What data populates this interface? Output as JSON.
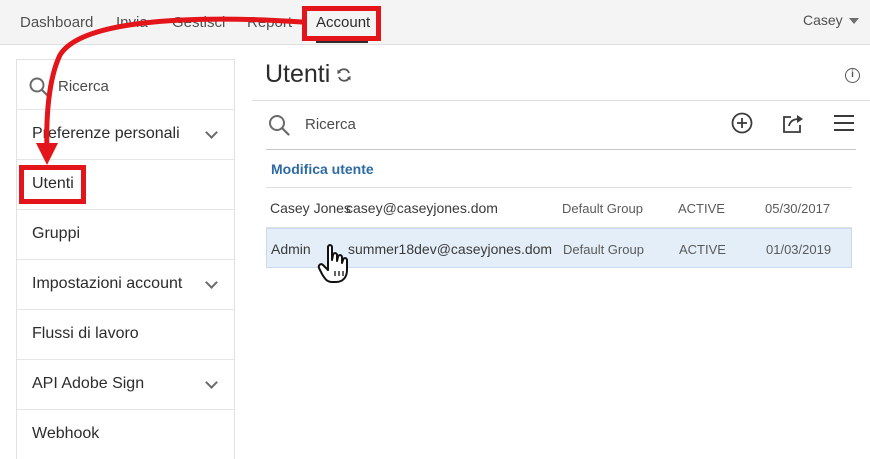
{
  "topnav": {
    "items": [
      {
        "label": "Dashboard"
      },
      {
        "label": "Invia"
      },
      {
        "label": "Gestisci"
      },
      {
        "label": "Report"
      },
      {
        "label": "Account"
      }
    ],
    "user": "Casey"
  },
  "sidebar": {
    "search_placeholder": "Ricerca",
    "items": [
      {
        "label": "Preferenze personali",
        "expandable": true
      },
      {
        "label": "Utenti",
        "expandable": false
      },
      {
        "label": "Gruppi",
        "expandable": false
      },
      {
        "label": "Impostazioni account",
        "expandable": true
      },
      {
        "label": "Flussi di lavoro",
        "expandable": false
      },
      {
        "label": "API Adobe Sign",
        "expandable": true
      },
      {
        "label": "Webhook",
        "expandable": false
      }
    ]
  },
  "main": {
    "title": "Utenti",
    "search_placeholder": "Ricerca",
    "section_link": "Modifica utente",
    "rows": [
      {
        "name": "Casey Jones",
        "email": "casey@caseyjones.dom",
        "group": "Default Group",
        "status": "ACTIVE",
        "date": "05/30/2017",
        "selected": false
      },
      {
        "name": "Admin",
        "email": "summer18dev@caseyjones.dom",
        "group": "Default Group",
        "status": "ACTIVE",
        "date": "01/03/2019",
        "selected": true
      }
    ]
  },
  "colors": {
    "highlight_red": "#e3151a",
    "link_blue": "#2d6ba5",
    "selected_row": "#e4eef8"
  },
  "icons": [
    "search-icon",
    "chevron-down-icon",
    "refresh-icon",
    "info-icon",
    "add-circle-icon",
    "share-icon",
    "hamburger-menu-icon",
    "hand-pointer-icon",
    "annotation-arrow"
  ]
}
